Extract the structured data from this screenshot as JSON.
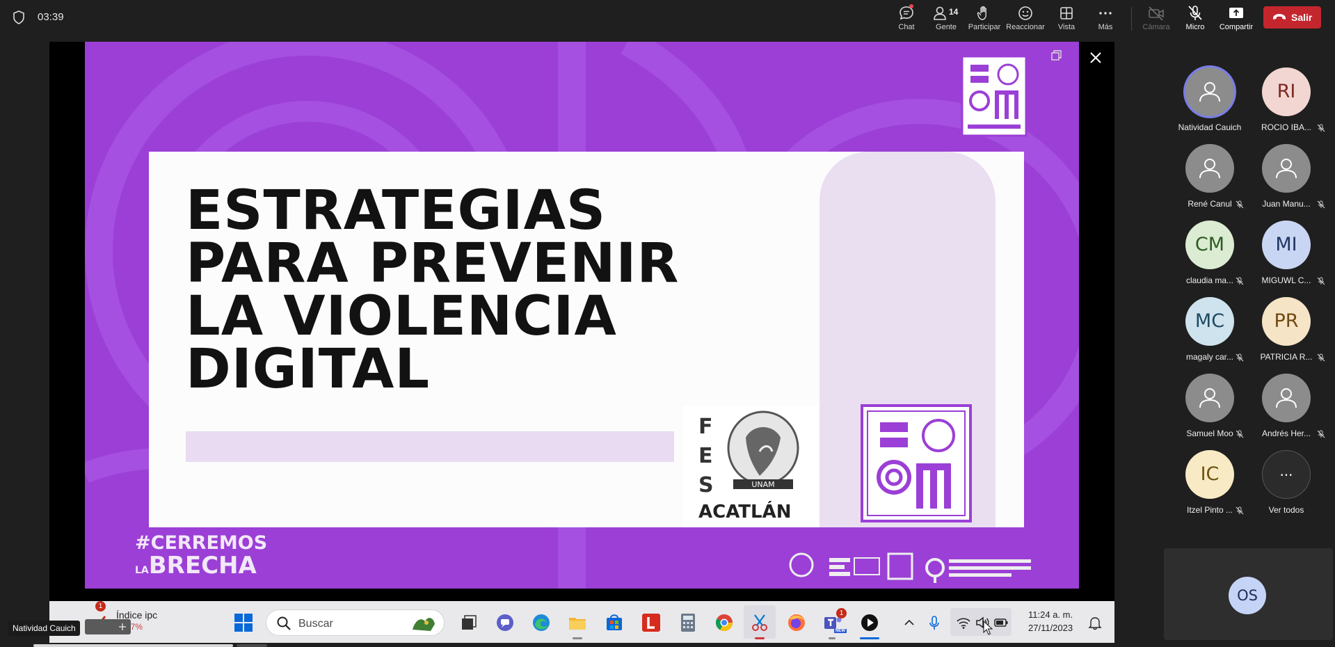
{
  "topbar": {
    "timer": "03:39",
    "buttons": {
      "chat": "Chat",
      "people": "Gente",
      "people_count": "14",
      "raise": "Participar",
      "react": "Reaccionar",
      "view": "Vista",
      "more": "Más",
      "camera": "Cámara",
      "mic": "Micro",
      "share": "Compartir",
      "leave": "Salir"
    },
    "leave_color": "#c4262e"
  },
  "slide": {
    "background": "#9b3fd6",
    "title_lines": [
      "ESTRATEGIAS",
      "PARA PREVENIR",
      "LA VIOLENCIA",
      "DIGITAL"
    ],
    "fes_letters": [
      "F",
      "E",
      "S"
    ],
    "unam": "UNAM",
    "acatlan": "ACATLÁN",
    "hashtag_line1": "#CERREMOS",
    "hashtag_line2_small": "LA",
    "hashtag_line2": "BRECHA"
  },
  "taskbar": {
    "weather_title": "Índice ipc",
    "weather_value": "-1.07%",
    "weather_badge": "1",
    "search_placeholder": "Buscar",
    "teams_badge": "1",
    "teams_new": "NEW",
    "time": "11:24 a. m.",
    "date": "27/11/2023",
    "icons": [
      "windows-start",
      "search",
      "task-view",
      "teams-chat",
      "edge",
      "file-explorer",
      "microsoft-store",
      "l-app",
      "calculator",
      "chrome",
      "snipping-tool",
      "firefox",
      "teams",
      "media-player",
      "chevron-up",
      "microphone",
      "wifi",
      "speaker",
      "battery",
      "notifications"
    ]
  },
  "self_tag": "Natividad Cauich",
  "participants": [
    {
      "initials": "",
      "name": "Natividad Cauich",
      "muted": false,
      "color": "#8c8c8c",
      "text_color": "#ffffff"
    },
    {
      "initials": "RI",
      "name": "ROCIO IBA...",
      "muted": true,
      "color": "#f2d6d2",
      "text_color": "#7b2a22"
    },
    {
      "initials": "",
      "name": "René Canul",
      "muted": true,
      "color": "#8c8c8c",
      "text_color": "#ffffff"
    },
    {
      "initials": "",
      "name": "Juan Manu...",
      "muted": true,
      "color": "#8c8c8c",
      "text_color": "#ffffff"
    },
    {
      "initials": "CM",
      "name": "claudia ma...",
      "muted": true,
      "color": "#dbecd3",
      "text_color": "#2e5b24"
    },
    {
      "initials": "MI",
      "name": "MIGUWL C...",
      "muted": true,
      "color": "#c9d6f3",
      "text_color": "#1f3563"
    },
    {
      "initials": "MC",
      "name": "magaly car...",
      "muted": true,
      "color": "#cfe3ee",
      "text_color": "#1f4a61"
    },
    {
      "initials": "PR",
      "name": "PATRICIA R...",
      "muted": true,
      "color": "#f6e4c6",
      "text_color": "#6f4a12"
    },
    {
      "initials": "",
      "name": "Samuel Moo",
      "muted": true,
      "color": "#8c8c8c",
      "text_color": "#ffffff"
    },
    {
      "initials": "",
      "name": "Andrés Her...",
      "muted": true,
      "color": "#8c8c8c",
      "text_color": "#ffffff"
    },
    {
      "initials": "IC",
      "name": "Itzel Pinto ...",
      "muted": true,
      "color": "#f8eac4",
      "text_color": "#6d5310"
    },
    {
      "initials": "···",
      "name": "Ver todos",
      "muted": false,
      "color": "#2b2b2b",
      "text_color": "#ffffff"
    }
  ],
  "self_view_initials": "OS"
}
